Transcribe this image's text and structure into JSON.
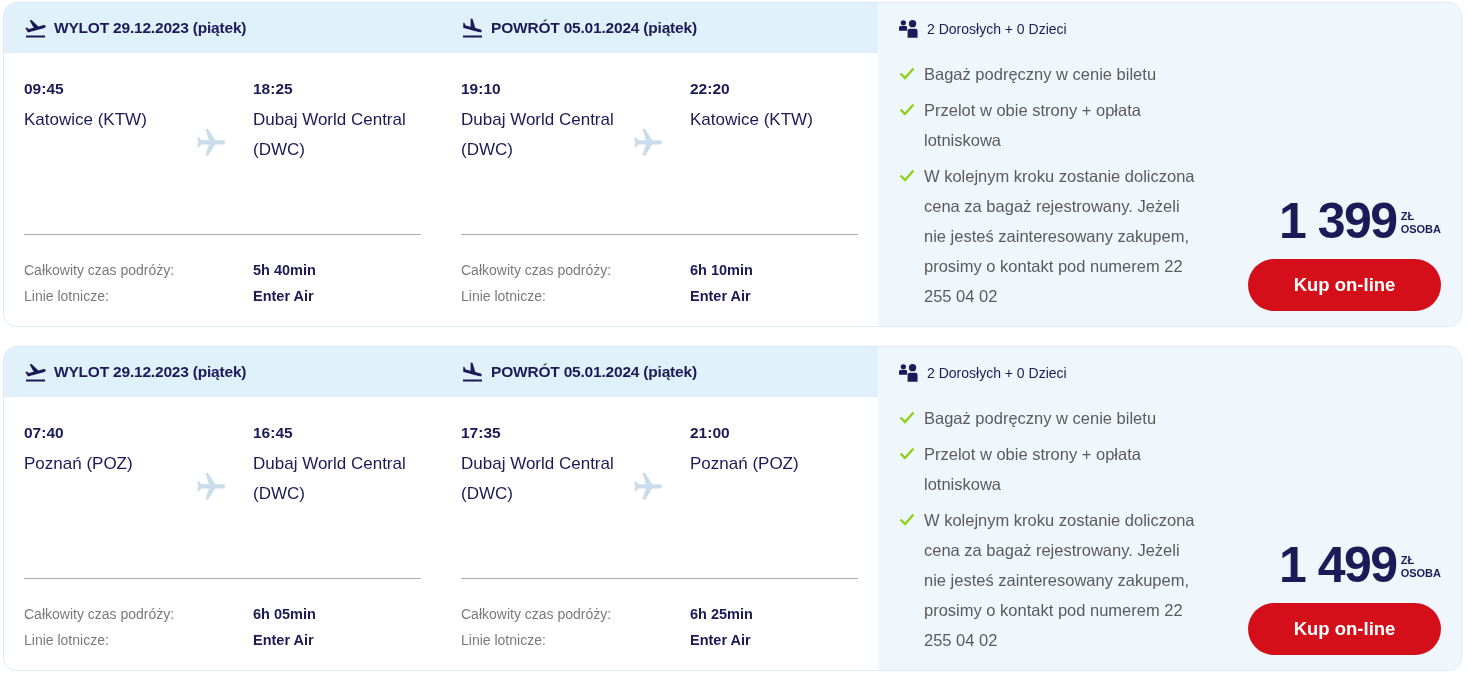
{
  "offers": [
    {
      "legs": [
        {
          "kind": "outbound",
          "heading": "WYLOT 29.12.2023 (piątek)",
          "from": {
            "time": "09:45",
            "airport": "Katowice (KTW)"
          },
          "to": {
            "time": "18:25",
            "airport": "Dubaj World Central (DWC)"
          },
          "details": [
            {
              "label": "Całkowity czas podróży:",
              "value": "5h 40min"
            },
            {
              "label": "Linie lotnicze:",
              "value": "Enter Air"
            }
          ]
        },
        {
          "kind": "return",
          "heading": "POWRÓT 05.01.2024 (piątek)",
          "from": {
            "time": "19:10",
            "airport": "Dubaj World Central (DWC)"
          },
          "to": {
            "time": "22:20",
            "airport": "Katowice (KTW)"
          },
          "details": [
            {
              "label": "Całkowity czas podróży:",
              "value": "6h 10min"
            },
            {
              "label": "Linie lotnicze:",
              "value": "Enter Air"
            }
          ]
        }
      ],
      "passengers": "2 Dorosłych + 0 Dzieci",
      "features": [
        "Bagaż podręczny w cenie biletu",
        "Przelot w obie strony + opłata lotniskowa",
        "W kolejnym kroku zostanie doliczona cena za bagaż rejestrowany. Jeżeli nie jesteś zainteresowany zakupem, prosimy o kontakt pod numerem 22 255 04 02"
      ],
      "price": {
        "amount": "1 399",
        "currency": "ZŁ",
        "unit": "OSOBA"
      },
      "button": "Kup on-line"
    },
    {
      "legs": [
        {
          "kind": "outbound",
          "heading": "WYLOT 29.12.2023 (piątek)",
          "from": {
            "time": "07:40",
            "airport": "Poznań (POZ)"
          },
          "to": {
            "time": "16:45",
            "airport": "Dubaj World Central (DWC)"
          },
          "details": [
            {
              "label": "Całkowity czas podróży:",
              "value": "6h 05min"
            },
            {
              "label": "Linie lotnicze:",
              "value": "Enter Air"
            }
          ]
        },
        {
          "kind": "return",
          "heading": "POWRÓT 05.01.2024 (piątek)",
          "from": {
            "time": "17:35",
            "airport": "Dubaj World Central (DWC)"
          },
          "to": {
            "time": "21:00",
            "airport": "Poznań (POZ)"
          },
          "details": [
            {
              "label": "Całkowity czas podróży:",
              "value": "6h 25min"
            },
            {
              "label": "Linie lotnicze:",
              "value": "Enter Air"
            }
          ]
        }
      ],
      "passengers": "2 Dorosłych + 0 Dzieci",
      "features": [
        "Bagaż podręczny w cenie biletu",
        "Przelot w obie strony + opłata lotniskowa",
        "W kolejnym kroku zostanie doliczona cena za bagaż rejestrowany. Jeżeli nie jesteś zainteresowany zakupem, prosimy o kontakt pod numerem 22 255 04 02"
      ],
      "price": {
        "amount": "1 499",
        "currency": "ZŁ",
        "unit": "OSOBA"
      },
      "button": "Kup on-line"
    }
  ]
}
